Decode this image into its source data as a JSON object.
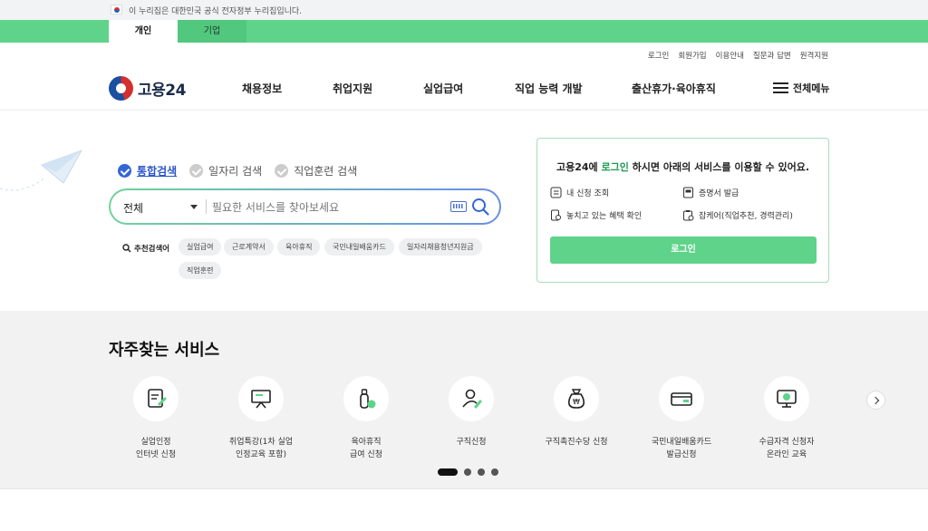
{
  "gov_banner": {
    "text": "이 누리집은 대한민국 공식 전자정부 누리집입니다."
  },
  "tabs": [
    {
      "label": "개인"
    },
    {
      "label": "기업"
    }
  ],
  "utility_links": [
    "로그인",
    "회원가입",
    "이용안내",
    "질문과 답변",
    "원격지원"
  ],
  "logo": {
    "text": "고용24"
  },
  "nav": [
    "채용정보",
    "취업지원",
    "실업급여",
    "직업 능력 개발",
    "출산휴가·육아휴직"
  ],
  "menu_all": "전체메뉴",
  "search": {
    "tabs": [
      "통합검색",
      "일자리 검색",
      "직업훈련 검색"
    ],
    "active_tab": "통합검색",
    "scope": "전체",
    "placeholder": "필요한 서비스를 찾아보세요",
    "recommend_label": "추천검색어",
    "keywords": [
      "실업급여",
      "근로계약서",
      "육아휴직",
      "국민내일배움카드",
      "일자리채용청년지원금",
      "직업훈련"
    ]
  },
  "login_box": {
    "msg_prefix": "고용24에 ",
    "msg_highlight": "로그인",
    "msg_suffix": " 하시면 아래의 서비스를 이용할 수 있어요.",
    "services": [
      "내 신청 조회",
      "증명서 발급",
      "놓치고 있는 혜택 확인",
      "잡케어(직업추천, 경력관리)"
    ],
    "button": "로그인"
  },
  "frequent": {
    "title": "자주찾는 서비스",
    "items": [
      {
        "label": "실업인정\n인터넷 신청",
        "icon": "document-pen-icon"
      },
      {
        "label": "취업특강(1차 실업\n인정교육 포함)",
        "icon": "presentation-board-icon"
      },
      {
        "label": "육아휴직\n급여 신청",
        "icon": "baby-bottle-icon"
      },
      {
        "label": "구직신청",
        "icon": "person-pen-icon"
      },
      {
        "label": "구직촉진수당 신청",
        "icon": "money-bag-icon"
      },
      {
        "label": "국민내일배움카드\n발급신청",
        "icon": "card-icon"
      },
      {
        "label": "수급자격 신청자\n온라인 교육",
        "icon": "monitor-play-icon"
      }
    ],
    "page_count": 4,
    "active_page": 0
  },
  "colors": {
    "green": "#5fd38a",
    "blue": "#3366d6",
    "highlight": "#1d9a52"
  }
}
